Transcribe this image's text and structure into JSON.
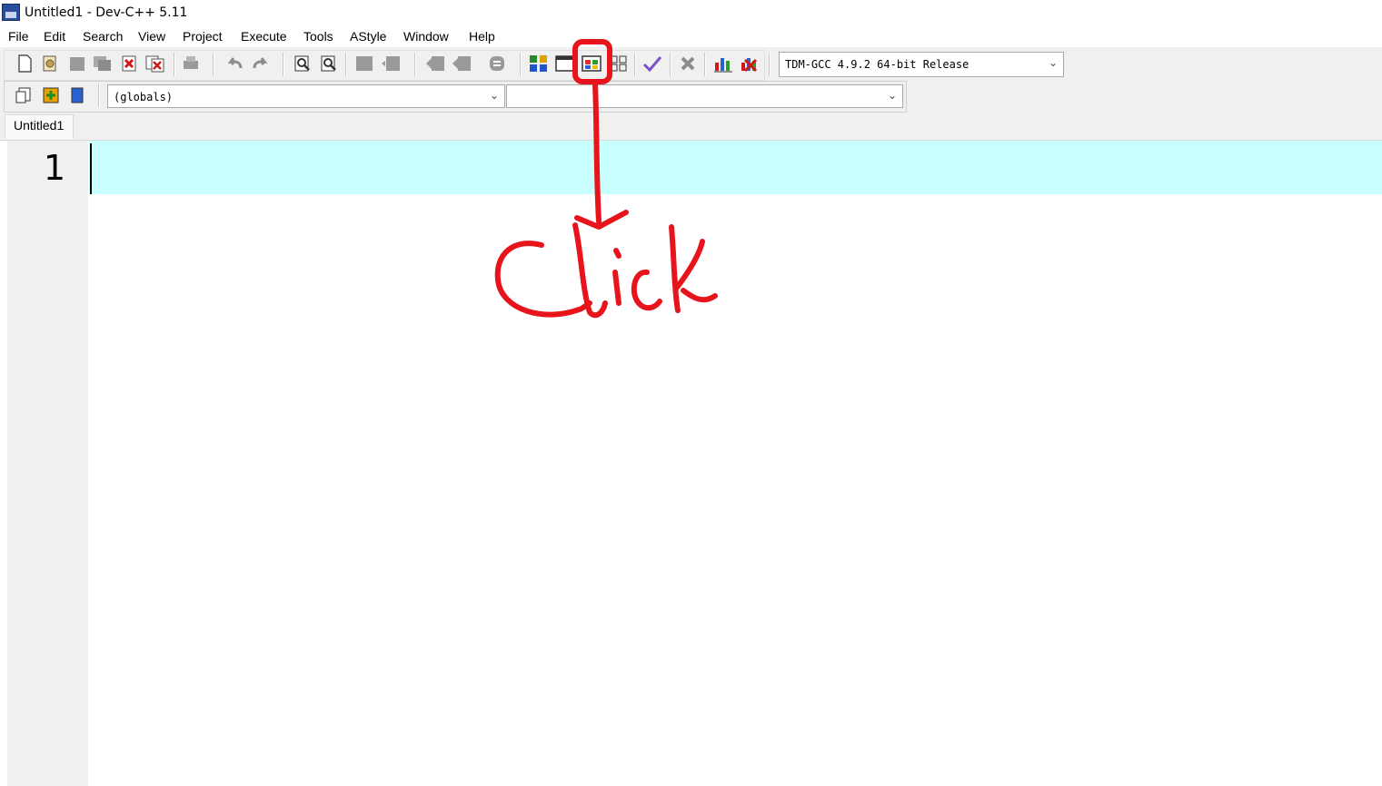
{
  "window": {
    "title": "Untitled1 - Dev-C++ 5.11"
  },
  "menu": [
    "File",
    "Edit",
    "Search",
    "View",
    "Project",
    "Execute",
    "Tools",
    "AStyle",
    "Window",
    "Help"
  ],
  "toolbar": {
    "compiler_select": "TDM-GCC 4.9.2 64-bit Release",
    "scope_select": "(globals)",
    "member_select": ""
  },
  "editor": {
    "tab_label": "Untitled1",
    "line_number": "1"
  },
  "annotation": {
    "text": "Click",
    "color": "#e8141c"
  },
  "colors": {
    "current_line": "#c8ffff",
    "gutter": "#f0f0f0"
  }
}
